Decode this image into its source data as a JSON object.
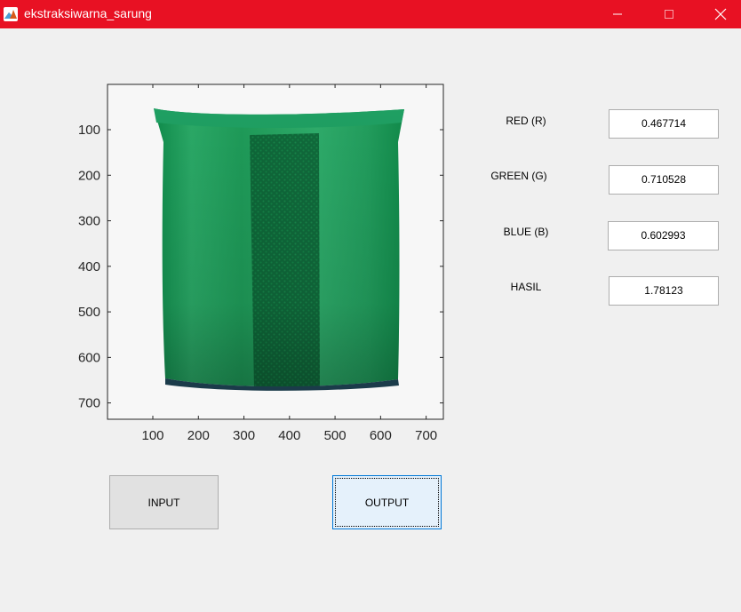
{
  "window": {
    "title": "ekstraksiwarna_sarung",
    "accent": "#e81123"
  },
  "axes": {
    "x_ticks": [
      "100",
      "200",
      "300",
      "400",
      "500",
      "600",
      "700"
    ],
    "y_ticks": [
      "100",
      "200",
      "300",
      "400",
      "500",
      "600",
      "700"
    ],
    "image_content": "green sarung cloth"
  },
  "labels": {
    "red": "RED (R)",
    "green": "GREEN (G)",
    "blue": "BLUE (B)",
    "hasil": "HASIL"
  },
  "values": {
    "red": "0.467714",
    "green": "0.710528",
    "blue": "0.602993",
    "hasil": "1.78123"
  },
  "buttons": {
    "input": "INPUT",
    "output": "OUTPUT"
  }
}
